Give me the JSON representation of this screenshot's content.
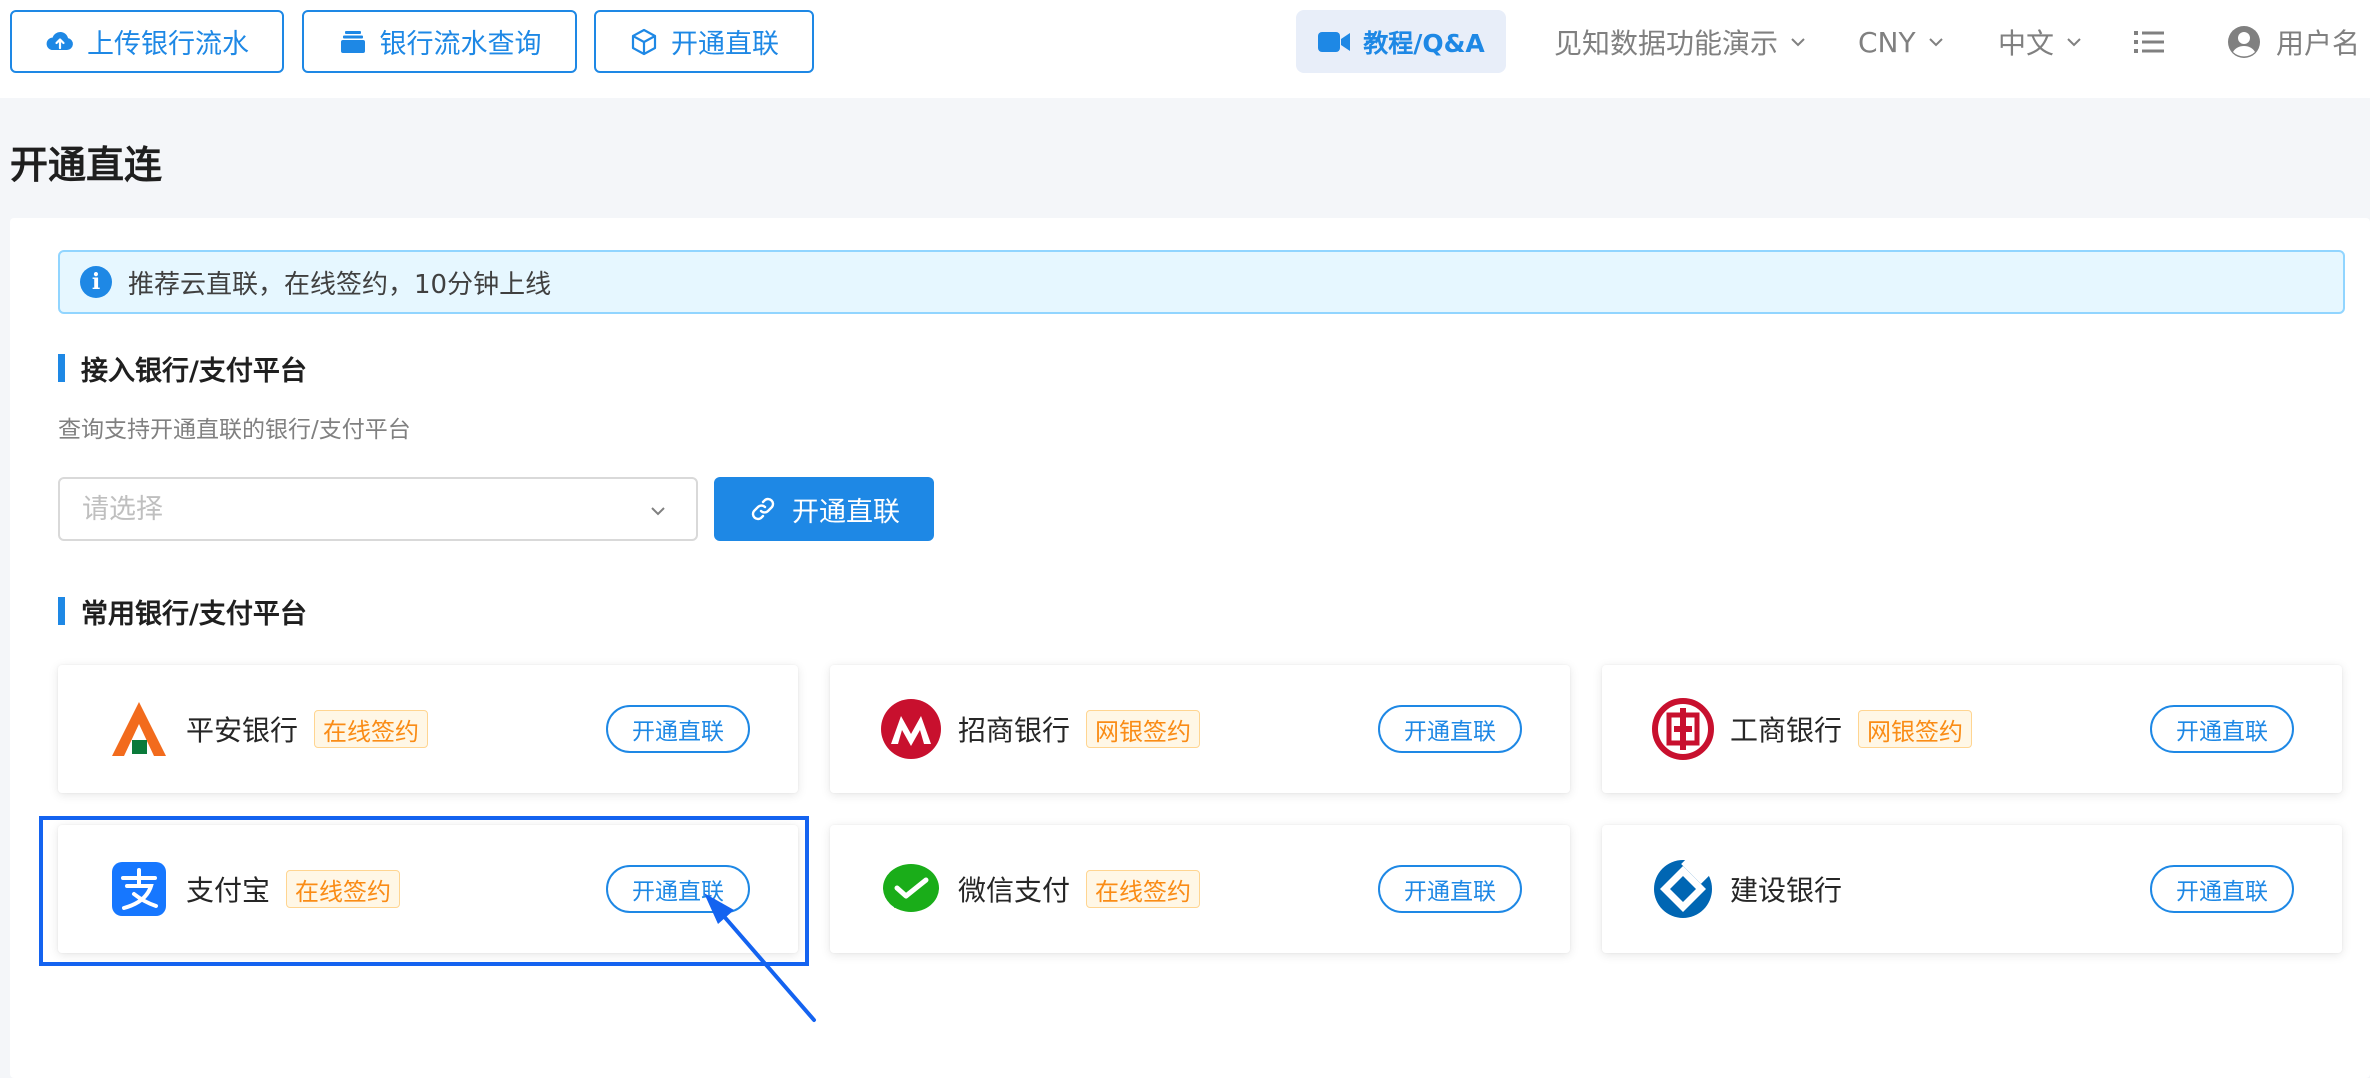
{
  "topbar": {
    "upload_label": "上传银行流水",
    "query_label": "银行流水查询",
    "connect_label": "开通直联",
    "tutorial_label": "教程/Q&A",
    "demo_label": "见知数据功能演示",
    "currency_label": "CNY",
    "language_label": "中文",
    "user_label": "用户名"
  },
  "page": {
    "title": "开通直连"
  },
  "alert": {
    "text": "推荐云直联，在线签约，10分钟上线"
  },
  "access_section": {
    "title": "接入银行/支付平台",
    "description": "查询支持开通直联的银行/支付平台",
    "select_placeholder": "请选择",
    "button_label": "开通直联"
  },
  "common_section": {
    "title": "常用银行/支付平台",
    "cards": [
      {
        "name": "平安银行",
        "tag": "在线签约",
        "button": "开通直联",
        "logo": "pingan-logo"
      },
      {
        "name": "招商银行",
        "tag": "网银签约",
        "button": "开通直联",
        "logo": "cmb-logo"
      },
      {
        "name": "工商银行",
        "tag": "网银签约",
        "button": "开通直联",
        "logo": "icbc-logo"
      },
      {
        "name": "支付宝",
        "tag": "在线签约",
        "button": "开通直联",
        "logo": "alipay-logo"
      },
      {
        "name": "微信支付",
        "tag": "在线签约",
        "button": "开通直联",
        "logo": "wechat-pay-logo"
      },
      {
        "name": "建设银行",
        "tag": "",
        "button": "开通直联",
        "logo": "ccb-logo"
      }
    ]
  },
  "colors": {
    "primary": "#1e88e5",
    "tag_orange": "#fa8c16",
    "highlight": "#1463f0"
  }
}
